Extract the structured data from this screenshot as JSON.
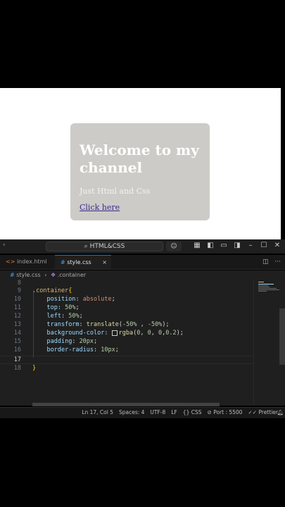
{
  "preview": {
    "heading": "Welcome to my channel",
    "subtext": "Just Html and Css",
    "link": "Click here"
  },
  "titlebar": {
    "search_label": "HTML&CSS",
    "icons": [
      "copilot-icon",
      "layout-icon",
      "toggle-sidebar-icon",
      "toggle-panel-icon",
      "toggle-secondary-icon",
      "minimize-icon",
      "maximize-icon",
      "close-icon"
    ]
  },
  "tabs": [
    {
      "label": "index.html",
      "icon": "html-icon",
      "active": false
    },
    {
      "label": "style.css",
      "icon": "css-icon",
      "active": true
    }
  ],
  "tab_close": "×",
  "tab_actions": [
    "split-editor-icon",
    "more-actions-icon"
  ],
  "breadcrumb": {
    "file": "style.css",
    "symbol": ".container"
  },
  "code_lines": [
    {
      "n": "8",
      "text": ""
    },
    {
      "n": "9",
      "text": ".container{"
    },
    {
      "n": "10",
      "text": "    position: absolute;"
    },
    {
      "n": "11",
      "text": "    top: 50%;"
    },
    {
      "n": "12",
      "text": "    left: 50%;"
    },
    {
      "n": "13",
      "text": "    transform: translate(-50% , -50%);"
    },
    {
      "n": "14",
      "text": "    background-color: rgba(0, 0, 0,0.2);"
    },
    {
      "n": "15",
      "text": "    padding: 20px;"
    },
    {
      "n": "16",
      "text": "    border-radius: 10px;"
    },
    {
      "n": "17",
      "text": ""
    },
    {
      "n": "18",
      "text": "}"
    }
  ],
  "status": {
    "position": "Ln 17, Col 5",
    "spaces": "Spaces: 4",
    "encoding": "UTF-8",
    "eol": "LF",
    "language": "CSS",
    "port": "Port : 5500",
    "prettier": "Prettier"
  }
}
